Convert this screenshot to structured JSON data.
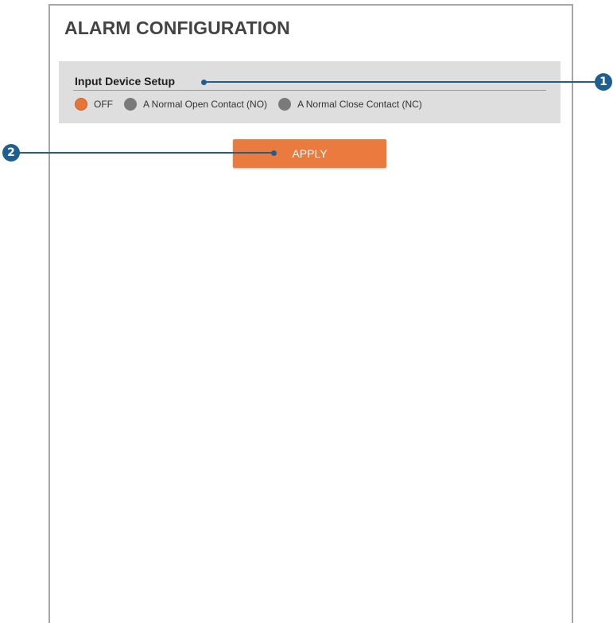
{
  "page": {
    "title": "ALARM CONFIGURATION"
  },
  "input_device_setup": {
    "title": "Input Device Setup",
    "options": [
      {
        "label": "OFF",
        "checked": true
      },
      {
        "label": "A Normal Open Contact (NO)",
        "checked": false
      },
      {
        "label": "A Normal Close Contact (NC)",
        "checked": false
      }
    ]
  },
  "actions": {
    "apply_label": "APPLY"
  },
  "callouts": [
    {
      "label": "1"
    },
    {
      "label": "2"
    }
  ],
  "colors": {
    "accent": "#ea7a3e",
    "callout": "#1f5f8f",
    "section_bg": "#dedede",
    "radio_unchecked": "#7a7a7a"
  }
}
